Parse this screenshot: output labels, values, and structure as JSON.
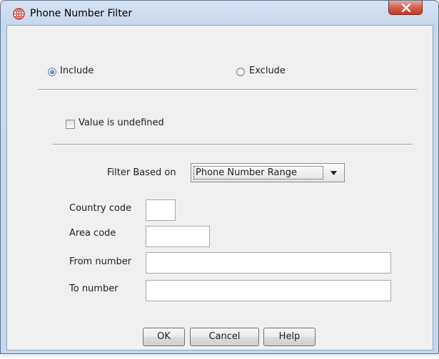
{
  "window": {
    "title": "Phone Number Filter",
    "icon": "globe-icon",
    "close_glyph": "x"
  },
  "mode": {
    "include_label": "Include",
    "exclude_label": "Exclude",
    "selected": "include"
  },
  "undefined_checkbox": {
    "label": "Value is undefined",
    "checked": false
  },
  "filter": {
    "label": "Filter Based on",
    "selected": "Phone Number Range"
  },
  "fields": {
    "country_code": {
      "label": "Country code",
      "value": ""
    },
    "area_code": {
      "label": "Area code",
      "value": ""
    },
    "from_number": {
      "label": "From number",
      "value": ""
    },
    "to_number": {
      "label": "To number",
      "value": ""
    }
  },
  "buttons": {
    "ok": "OK",
    "cancel": "Cancel",
    "help": "Help"
  },
  "colors": {
    "accent_icon": "#c0392b",
    "radio_selected": "#1d5fa8",
    "close_button": "#c0392b"
  }
}
